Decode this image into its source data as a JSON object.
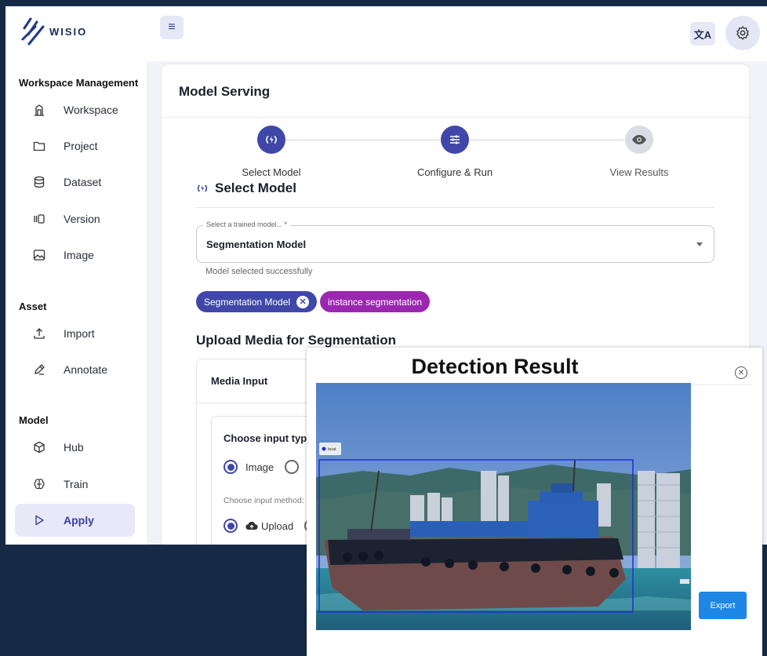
{
  "app": {
    "logo_text": "WISIO"
  },
  "header": {
    "translate_icon": "translate-icon",
    "settings_icon": "gear-icon",
    "menu_icon": "hamburger-icon",
    "translate_glyph": "文A"
  },
  "sidebar": {
    "sections": [
      {
        "title": "Workspace Management",
        "items": [
          {
            "label": "Workspace",
            "icon": "building-icon"
          },
          {
            "label": "Project",
            "icon": "folder-icon"
          },
          {
            "label": "Dataset",
            "icon": "database-icon"
          },
          {
            "label": "Version",
            "icon": "version-icon"
          },
          {
            "label": "Image",
            "icon": "image-icon"
          }
        ]
      },
      {
        "title": "Asset",
        "items": [
          {
            "label": "Import",
            "icon": "upload-icon"
          },
          {
            "label": "Annotate",
            "icon": "edit-icon"
          }
        ]
      },
      {
        "title": "Model",
        "items": [
          {
            "label": "Hub",
            "icon": "cube-icon"
          },
          {
            "label": "Train",
            "icon": "brain-icon"
          },
          {
            "label": "Apply",
            "icon": "play-icon",
            "active": true
          }
        ]
      }
    ]
  },
  "main": {
    "title": "Model Serving",
    "steps": [
      {
        "label": "Select Model",
        "state": "active"
      },
      {
        "label": "Configure & Run",
        "state": "active"
      },
      {
        "label": "View Results",
        "state": "inactive"
      }
    ],
    "section_title": "Select Model",
    "select": {
      "legend": "Select a trained model... *",
      "value": "Segmentation Model",
      "helper": "Model selected successfully"
    },
    "chips": [
      {
        "label": "Segmentation Model",
        "color": "#3f48a8",
        "removable": true
      },
      {
        "label": "instance segmentation",
        "color": "#9b27b0",
        "removable": false
      }
    ],
    "upload_title": "Upload Media for Segmentation",
    "media_card": {
      "title": "Media Input",
      "input_type_label": "Choose input type:",
      "input_type_options": [
        {
          "label": "Image",
          "selected": true
        },
        {
          "label": "",
          "selected": false
        }
      ],
      "input_method_label": "Choose input method:",
      "input_method_options": [
        {
          "label": "Upload",
          "selected": true,
          "icon": "cloud-upload-icon"
        }
      ]
    }
  },
  "modal": {
    "title": "Detection Result",
    "close_icon": "close-circle-icon",
    "export_label": "Export",
    "detection_label": "boat",
    "export_color": "#1e86e4"
  },
  "colors": {
    "primary": "#3f48a8",
    "secondary": "#9b27b0",
    "background": "#172a45"
  }
}
